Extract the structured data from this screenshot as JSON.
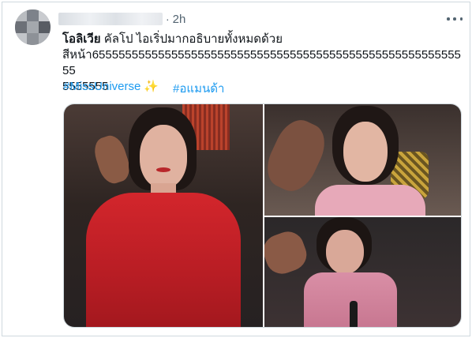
{
  "post": {
    "time_sep": "·",
    "timestamp": "2h",
    "author_bold": "โอลิเวีย",
    "text_line1_rest": " คัลโป ไอเริ่ปมากอธิบายทั้งหมดด้วย",
    "text_line2": "สีหน้า6555555555555555555555555555555555555555555555555555555555",
    "text_line3": "5555555",
    "hashtags": [
      "#MissUniverse",
      "#อแมนด้า"
    ],
    "hashtag_emoji": "✨"
  },
  "media": {
    "photos": [
      "photo-1",
      "photo-2",
      "photo-3"
    ]
  },
  "icons": {
    "more": "more-options-icon"
  },
  "colors": {
    "link": "#1d9bf0",
    "secondary_text": "#536471",
    "border": "#cfd9de",
    "dress_red": "#d3262c"
  }
}
